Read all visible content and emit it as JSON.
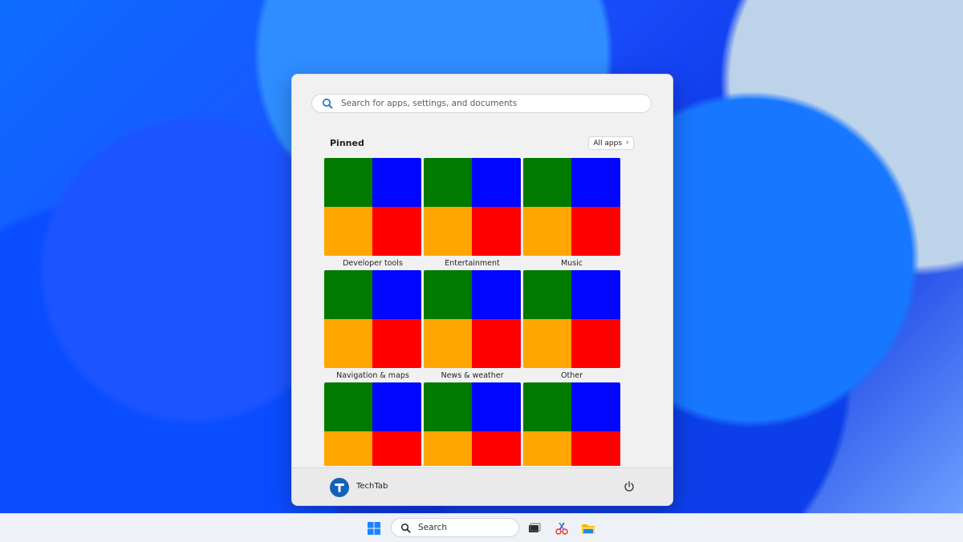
{
  "start_menu": {
    "search_placeholder": "Search for apps, settings, and documents",
    "pinned_label": "Pinned",
    "all_apps_label": "All apps",
    "tiles": [
      {
        "label": "Developer tools"
      },
      {
        "label": "Entertainment"
      },
      {
        "label": "Music"
      },
      {
        "label": "Navigation & maps"
      },
      {
        "label": "News & weather"
      },
      {
        "label": "Other"
      },
      {
        "label": ""
      },
      {
        "label": ""
      },
      {
        "label": ""
      }
    ],
    "user_name": "TechTab"
  },
  "taskbar": {
    "search_label": "Search"
  },
  "colors": {
    "tile_green": "#017a00",
    "tile_blue": "#0006ff",
    "tile_orange": "#ffa500",
    "tile_red": "#ff0000",
    "accent": "#0f6cbd"
  }
}
